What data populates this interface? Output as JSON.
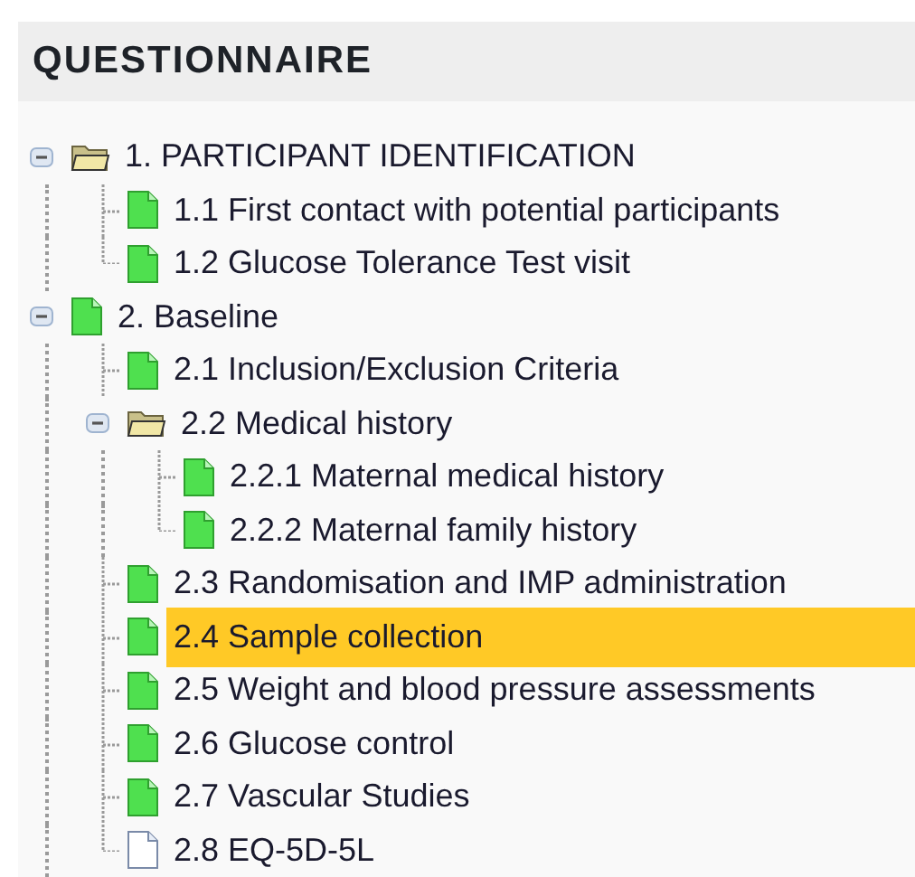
{
  "panel": {
    "title": "QUESTIONNAIRE"
  },
  "tree": [
    {
      "label": "1. PARTICIPANT IDENTIFICATION",
      "kind": "folder",
      "expanded": true,
      "selected": false,
      "children": [
        {
          "label": "1.1 First contact with potential participants",
          "kind": "form-complete",
          "selected": false
        },
        {
          "label": "1.2 Glucose Tolerance Test visit",
          "kind": "form-complete",
          "selected": false
        }
      ]
    },
    {
      "label": "2. Baseline",
      "kind": "form-complete",
      "expanded": true,
      "selected": false,
      "children": [
        {
          "label": "2.1 Inclusion/Exclusion Criteria",
          "kind": "form-complete",
          "selected": false
        },
        {
          "label": "2.2 Medical history",
          "kind": "folder",
          "expanded": true,
          "selected": false,
          "children": [
            {
              "label": "2.2.1 Maternal medical history",
              "kind": "form-complete",
              "selected": false
            },
            {
              "label": "2.2.2 Maternal family history",
              "kind": "form-complete",
              "selected": false
            }
          ]
        },
        {
          "label": "2.3 Randomisation and IMP administration",
          "kind": "form-complete",
          "selected": false
        },
        {
          "label": "2.4 Sample collection",
          "kind": "form-complete",
          "selected": true
        },
        {
          "label": "2.5 Weight and blood pressure assessments",
          "kind": "form-complete",
          "selected": false
        },
        {
          "label": "2.6 Glucose control",
          "kind": "form-complete",
          "selected": false
        },
        {
          "label": "2.7 Vascular Studies",
          "kind": "form-complete",
          "selected": false
        },
        {
          "label": "2.8 EQ-5D-5L",
          "kind": "form-empty",
          "selected": false
        }
      ]
    }
  ]
}
